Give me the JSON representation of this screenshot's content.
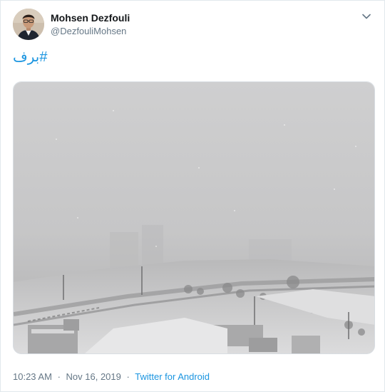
{
  "tweet": {
    "author_name": "Mohsen Dezfouli",
    "author_handle": "@DezfouliMohsen",
    "text": "#برف",
    "time": "10:23 AM",
    "date": "Nov 16, 2019",
    "separator": "·",
    "source": "Twitter for Android"
  },
  "icons": {
    "menu": "chevron-down-icon",
    "avatar": "profile-photo"
  },
  "colors": {
    "link": "#1b95e0",
    "secondary_text": "#657786",
    "primary_text": "#14171a"
  }
}
